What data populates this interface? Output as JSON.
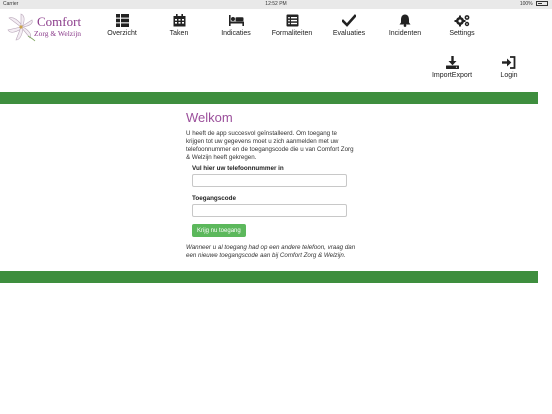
{
  "statusbar": {
    "carrier": "Carrier",
    "time": "12:52 PM",
    "battery": "100%"
  },
  "app": {
    "brand_line1": "Comfort",
    "brand_line2": "Zorg & Welzijn"
  },
  "nav": {
    "items": [
      {
        "label": "Overzicht",
        "icon": "grid-list-icon"
      },
      {
        "label": "Taken",
        "icon": "calendar-icon"
      },
      {
        "label": "Indicaties",
        "icon": "bed-icon"
      },
      {
        "label": "Formaliteiten",
        "icon": "list-alt-icon"
      },
      {
        "label": "Evaluaties",
        "icon": "checkmark-icon"
      },
      {
        "label": "Incidenten",
        "icon": "bell-icon"
      },
      {
        "label": "Settings",
        "icon": "gears-icon"
      }
    ],
    "secondary": [
      {
        "label": "ImportExport",
        "icon": "download-icon"
      },
      {
        "label": "Login",
        "icon": "login-icon"
      }
    ]
  },
  "welcome": {
    "title": "Welkom",
    "intro": "U heeft de app succesvol geïnstalleerd. Om toegang te krijgen tot uw gegevens moet u zich aanmelden met uw telefoonnummer en de toegangscode die u van Comfort Zorg & Welzijn heeft gekregen.",
    "phone_label": "Vul hier uw telefoonnummer in",
    "phone_value": "",
    "code_label": "Toegangscode",
    "code_value": "",
    "submit_label": "Krijg nu toegang",
    "note": "Wanneer u al toegang had op een andere telefoon, vraag dan een nieuwe toegangscode aan bij Comfort Zorg & Welzijn."
  },
  "colors": {
    "accent_green": "#3e8e3e",
    "button_green": "#5cb85c",
    "brand_purple": "#9b4f9b"
  }
}
